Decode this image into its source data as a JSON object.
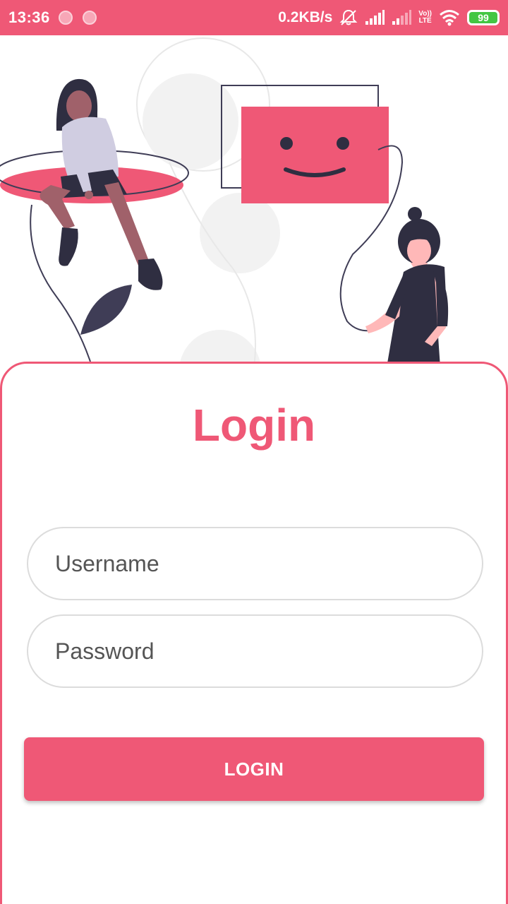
{
  "status_bar": {
    "time": "13:36",
    "net_speed": "0.2KB/s",
    "volte_top": "Vo))",
    "volte_bottom": "LTE",
    "battery": "99"
  },
  "login": {
    "title": "Login",
    "username_placeholder": "Username",
    "password_placeholder": "Password",
    "button_label": "LOGIN"
  },
  "colors": {
    "accent": "#ef5876",
    "dark": "#2f2e41",
    "light_gray": "#f2f2f2"
  }
}
